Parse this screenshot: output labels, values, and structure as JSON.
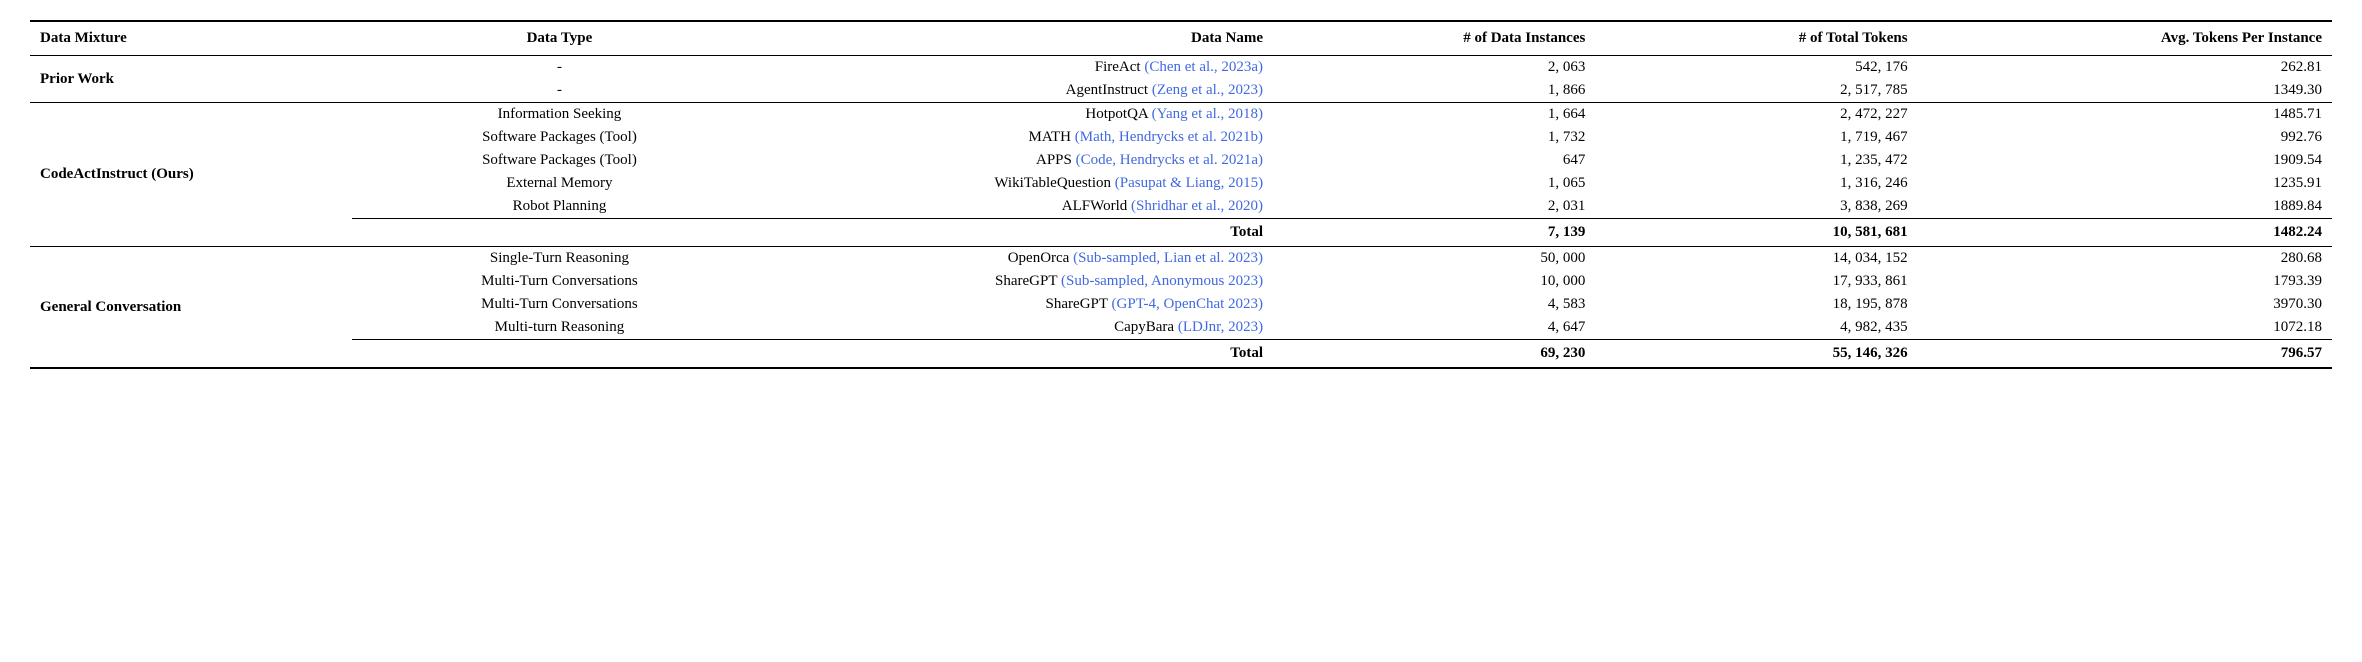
{
  "table": {
    "headers": [
      "Data Mixture",
      "Data Type",
      "Data Name",
      "# of Data Instances",
      "# of Total Tokens",
      "Avg. Tokens Per Instance"
    ],
    "sections": [
      {
        "mixture": "Prior Work",
        "rows": [
          {
            "type": "-",
            "name": "FireAct (Chen et al., 2023a)",
            "name_link": "Chen et al., 2023a",
            "instances": "2, 063",
            "tokens": "542, 176",
            "avg": "262.81"
          },
          {
            "type": "-",
            "name": "AgentInstruct (Zeng et al., 2023)",
            "name_link": "Zeng et al., 2023",
            "instances": "1, 866",
            "tokens": "2, 517, 785",
            "avg": "1349.30"
          }
        ],
        "total": null
      },
      {
        "mixture": "CodeActInstruct (Ours)",
        "mixture_bold_part": "CodeActInstruct",
        "mixture_normal_part": " (Ours)",
        "rows": [
          {
            "type": "Information Seeking",
            "name": "HotpotQA (Yang et al., 2018)",
            "name_link": "Yang et al., 2018",
            "instances": "1, 664",
            "tokens": "2, 472, 227",
            "avg": "1485.71"
          },
          {
            "type": "Software Packages (Tool)",
            "name": "MATH (Math, Hendrycks et al. 2021b)",
            "name_link": "Hendrycks et al. 2021b",
            "instances": "1, 732",
            "tokens": "1, 719, 467",
            "avg": "992.76"
          },
          {
            "type": "Software Packages (Tool)",
            "name": "APPS (Code, Hendrycks et al. 2021a)",
            "name_link": "Hendrycks et al. 2021a",
            "instances": "647",
            "tokens": "1, 235, 472",
            "avg": "1909.54"
          },
          {
            "type": "External Memory",
            "name": "WikiTableQuestion (Pasupat & Liang, 2015)",
            "name_link": "Pasupat & Liang, 2015",
            "instances": "1, 065",
            "tokens": "1, 316, 246",
            "avg": "1235.91"
          },
          {
            "type": "Robot Planning",
            "name": "ALFWorld (Shridhar et al., 2020)",
            "name_link": "Shridhar et al., 2020",
            "instances": "2, 031",
            "tokens": "3, 838, 269",
            "avg": "1889.84"
          }
        ],
        "total": {
          "label": "Total",
          "instances": "7, 139",
          "tokens": "10, 581, 681",
          "avg": "1482.24"
        }
      },
      {
        "mixture": "General Conversation",
        "rows": [
          {
            "type": "Single-Turn Reasoning",
            "name": "OpenOrca (Sub-sampled, Lian et al. 2023)",
            "name_link": "Lian et al. 2023",
            "instances": "50, 000",
            "tokens": "14, 034, 152",
            "avg": "280.68"
          },
          {
            "type": "Multi-Turn Conversations",
            "name": "ShareGPT (Sub-sampled, Anonymous 2023)",
            "name_link": "Anonymous 2023",
            "instances": "10, 000",
            "tokens": "17, 933, 861",
            "avg": "1793.39"
          },
          {
            "type": "Multi-Turn Conversations",
            "name": "ShareGPT (GPT-4, OpenChat 2023)",
            "name_link": "OpenChat 2023",
            "instances": "4, 583",
            "tokens": "18, 195, 878",
            "avg": "3970.30"
          },
          {
            "type": "Multi-turn Reasoning",
            "name": "CapyBara (LDJnr, 2023)",
            "name_link": "LDJnr, 2023",
            "instances": "4, 647",
            "tokens": "4, 982, 435",
            "avg": "1072.18"
          }
        ],
        "total": {
          "label": "Total",
          "instances": "69, 230",
          "tokens": "55, 146, 326",
          "avg": "796.57"
        }
      }
    ]
  }
}
